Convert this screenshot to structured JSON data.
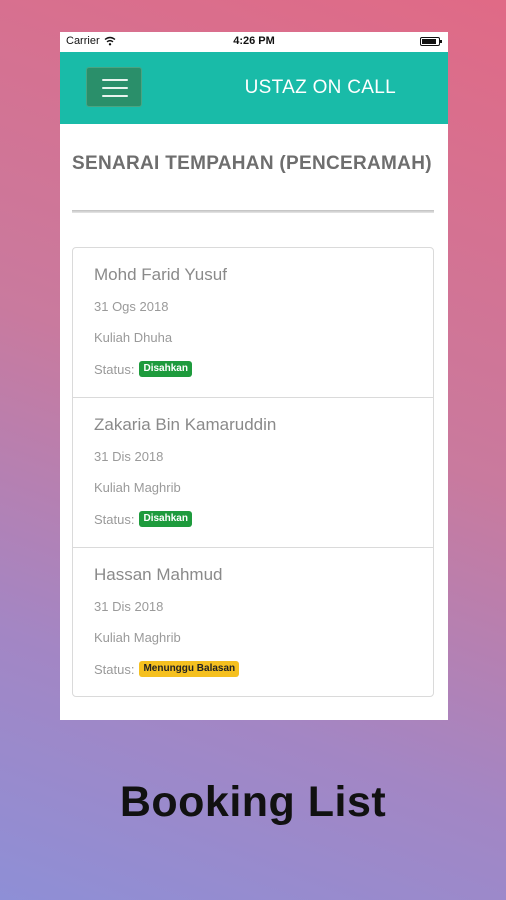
{
  "status_bar": {
    "carrier": "Carrier",
    "time": "4:26 PM"
  },
  "navbar": {
    "title": "USTAZ ON CALL"
  },
  "page": {
    "title": "SENARAI TEMPAHAN (PENCERAMAH)"
  },
  "bookings": [
    {
      "name": "Mohd Farid Yusuf",
      "date": "31 Ogs 2018",
      "type": "Kuliah Dhuha",
      "status_label": "Status:",
      "status": "Disahkan",
      "status_color": "#1e9b3d"
    },
    {
      "name": "Zakaria Bin Kamaruddin",
      "date": "31 Dis 2018",
      "type": "Kuliah Maghrib",
      "status_label": "Status:",
      "status": "Disahkan",
      "status_color": "#1e9b3d"
    },
    {
      "name": "Hassan Mahmud",
      "date": "31 Dis 2018",
      "type": "Kuliah Maghrib",
      "status_label": "Status:",
      "status": "Menunggu Balasan",
      "status_color": "#f5c01f"
    }
  ],
  "caption": "Booking List",
  "colors": {
    "navbar": "#19bba8",
    "menu_button": "#2a8f6a",
    "background_top": "#e06a86",
    "background_bottom": "#8e8fd6"
  }
}
